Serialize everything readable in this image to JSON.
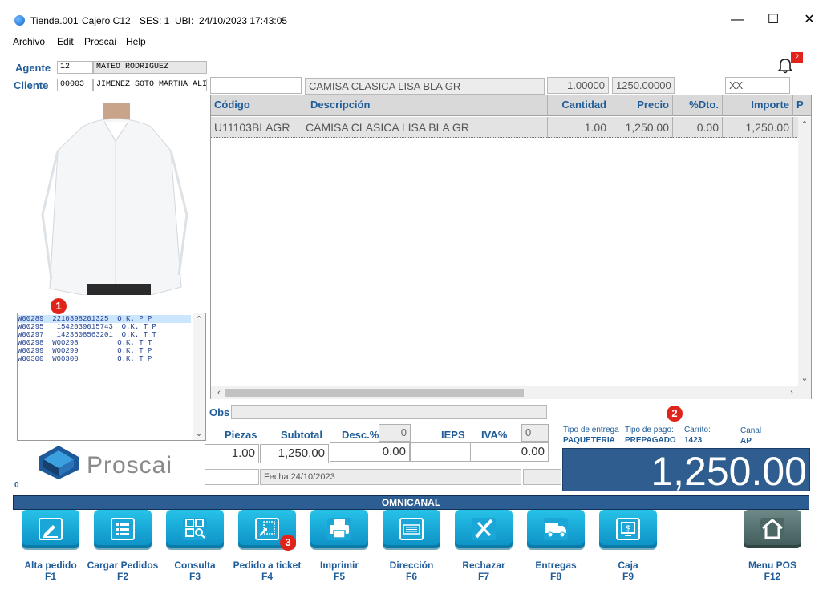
{
  "window": {
    "title_store": "Tienda.001",
    "title_cashier": "Cajero C12",
    "title_ses": "SES: 1",
    "title_ubi": "UBI:",
    "title_datetime": "24/10/2023 17:43:05",
    "minimize": "—",
    "maximize": "☐",
    "close": "✕"
  },
  "menu": [
    "Archivo",
    "Edit",
    "Proscai",
    "Help"
  ],
  "notifications": {
    "count": "2"
  },
  "agent": {
    "label": "Agente",
    "code": "12",
    "name": "MATEO RODRIGUEZ"
  },
  "client": {
    "label": "Cliente",
    "code": "00003",
    "name": "JIMENEZ SOTO MARTHA ALI"
  },
  "entry": {
    "code": "",
    "description": "CAMISA CLASICA LISA BLA GR",
    "quantity": "1.00000",
    "price": "1250.00000",
    "extra": "XX"
  },
  "grid": {
    "headers": [
      "Código",
      "Descripción",
      "Cantidad",
      "Precio",
      "%Dto.",
      "Importe",
      "P"
    ],
    "rows": [
      {
        "code": "U11103BLAGR",
        "description": "CAMISA CLASICA LISA BLA GR",
        "quantity": "1.00",
        "price": "1,250.00",
        "discount": "0.00",
        "amount": "1,250.00"
      }
    ]
  },
  "orders": [
    {
      "id": "W00289",
      "ref": "2210398201325",
      "status": "O.K. P P"
    },
    {
      "id": "W00295",
      "ref": " 1542039015743",
      "status": "O.K. T P"
    },
    {
      "id": "W00297",
      "ref": " 1423608563201",
      "status": "O.K. T T"
    },
    {
      "id": "W00298",
      "ref": "W00298",
      "status": "O.K. T T"
    },
    {
      "id": "W00299",
      "ref": "W00299",
      "status": "O.K. T P"
    },
    {
      "id": "W00300",
      "ref": "W00300",
      "status": "O.K. T P"
    }
  ],
  "markers": [
    "1",
    "2",
    "3"
  ],
  "logo": {
    "text": "Proscai"
  },
  "counter": "0",
  "obs": {
    "label": "Obs",
    "value": ""
  },
  "totals": {
    "pieces_label": "Piezas",
    "subtotal_label": "Subtotal",
    "desc_label": "Desc.%",
    "desc_pct": "0",
    "ieps_label": "IEPS",
    "iva_label": "IVA%",
    "iva_pct": "0",
    "pieces": "1.00",
    "subtotal": "1,250.00",
    "discount": "0.00",
    "ieps": "",
    "iva": "0.00",
    "date": "Fecha 24/10/2023"
  },
  "delivery": {
    "type_label": "Tipo de entrega",
    "type": "PAQUETERIA",
    "pay_label": "Tipo de pago:",
    "pay": "PREPAGADO",
    "cart_label": "Carrito:",
    "cart": "1423",
    "channel_label": "Canal",
    "channel": "AP"
  },
  "grand_total": "1,250.00",
  "channel_bar": "OMNICANAL",
  "buttons": [
    {
      "label": "Alta pedido",
      "key": "F1"
    },
    {
      "label": "Cargar Pedidos",
      "key": "F2"
    },
    {
      "label": "Consulta",
      "key": "F3"
    },
    {
      "label": "Pedido a ticket",
      "key": "F4"
    },
    {
      "label": "Imprimir",
      "key": "F5"
    },
    {
      "label": "Dirección",
      "key": "F6"
    },
    {
      "label": "Rechazar",
      "key": "F7"
    },
    {
      "label": "Entregas",
      "key": "F8"
    },
    {
      "label": "Caja",
      "key": "F9"
    },
    {
      "label": "Menu POS",
      "key": "F12"
    }
  ],
  "colors": {
    "accent": "#1f5c99",
    "total_bg": "#2f5d8f",
    "button": "#0c8fc4",
    "marker": "#e0231b"
  }
}
